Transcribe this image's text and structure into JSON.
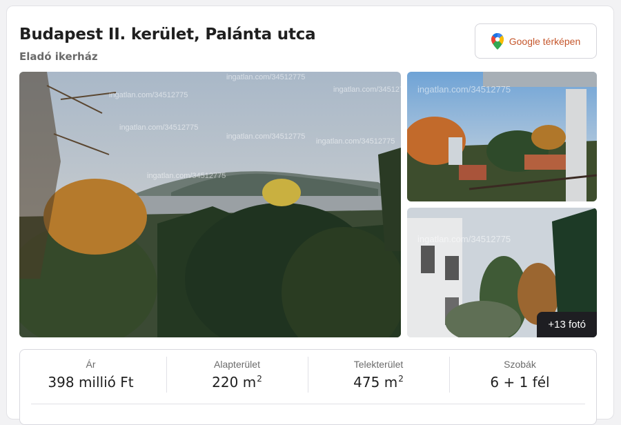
{
  "listing": {
    "title": "Budapest II. kerület, Palánta utca",
    "subtitle": "Eladó ikerház"
  },
  "maps_button": {
    "label": "Google térképen",
    "icon": "map-pin-icon",
    "color": "#c5562b"
  },
  "gallery": {
    "watermark": "ingatlan.com/34512775",
    "more_label": "+13 fotó"
  },
  "stats": [
    {
      "label": "Ár",
      "value": "398 millió Ft",
      "sup": ""
    },
    {
      "label": "Alapterület",
      "value": "220 m",
      "sup": "2"
    },
    {
      "label": "Telekterület",
      "value": "475 m",
      "sup": "2"
    },
    {
      "label": "Szobák",
      "value": "6 + 1 fél",
      "sup": ""
    }
  ]
}
